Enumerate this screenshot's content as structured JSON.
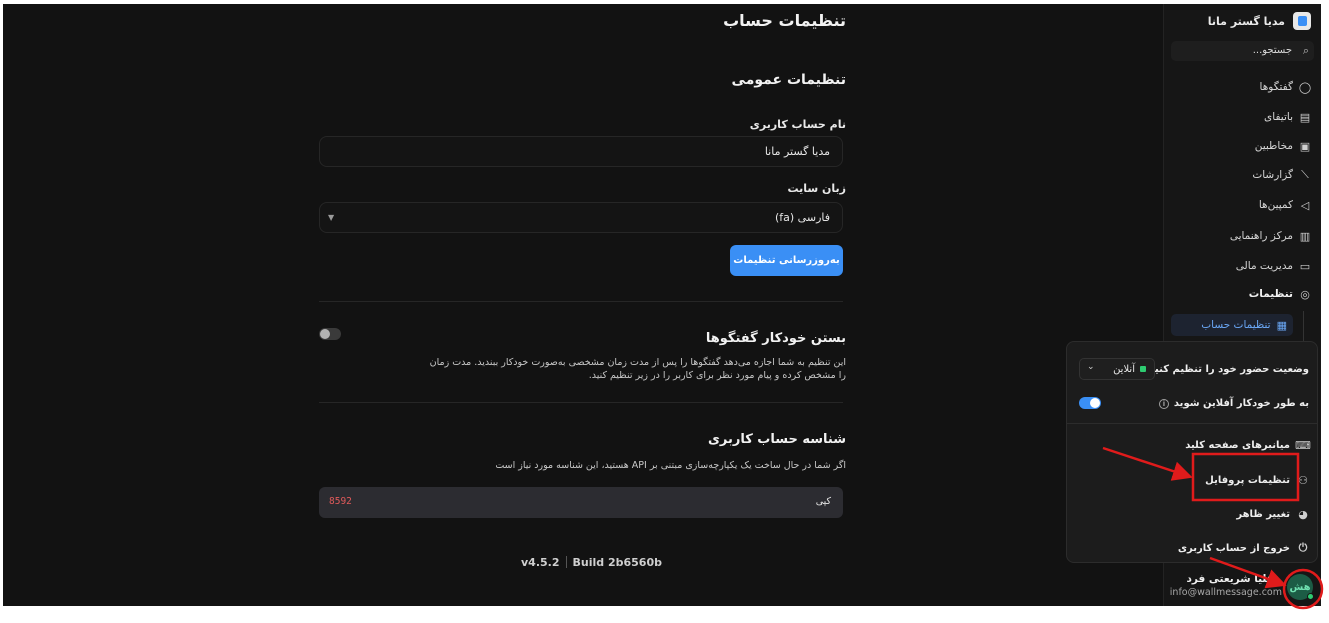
{
  "content": {
    "page_title": "تنظیمات حساب",
    "general_title": "تنظیمات عمومی",
    "username_label": "نام حساب کاربری",
    "username_value": "مدیا گستر مانا",
    "language_label": "زبان سایت",
    "language_value": "فارسی (fa)",
    "update_button": "به‌روزرسانی تنظیمات",
    "autoclose_title": "بستن خودکار گفتگوها",
    "autoclose_desc": "این تنظیم به شما اجازه می‌دهد گفتگوها را پس از مدت زمان مشخصی به‌صورت خودکار ببندید. مدت زمان را مشخص کرده و پیام مورد نظر برای کاربر را در زیر تنظیم کنید.",
    "api_title": "شناسه حساب کاربری",
    "api_desc": "اگر شما در حال ساخت یک یکپارچه‌سازی مبتنی بر API هستید، این شناسه مورد نیاز است",
    "api_label": "کپی",
    "api_value": "8592",
    "version": "v4.5.2",
    "build": "Build 2b6560b"
  },
  "sidebar": {
    "brand": "مدیا گستر مانا",
    "search_placeholder": "جستجو...",
    "items": [
      {
        "label": "گفتگوها",
        "icon": "chat-icon"
      },
      {
        "label": "باتیفای",
        "icon": "bot-icon"
      },
      {
        "label": "مخاطبین",
        "icon": "contacts-icon"
      },
      {
        "label": "گزارشات",
        "icon": "reports-icon"
      },
      {
        "label": "کمپین‌ها",
        "icon": "campaign-icon"
      },
      {
        "label": "مرکز راهنمایی",
        "icon": "help-center-icon"
      },
      {
        "label": "مدیریت مالی",
        "icon": "wallet-icon"
      },
      {
        "label": "تنظیمات",
        "icon": "settings-icon"
      }
    ],
    "active_sub": "تنظیمات حساب",
    "user": {
      "name": "هلیا شریعتی فرد",
      "email": "info@wallmessage.com",
      "initials": "هش"
    }
  },
  "popup": {
    "presence_label": "وضعیت حضور خود را تنظیم کنید",
    "status": "آنلاین",
    "auto_offline": "به طور خودکار آفلاین شوید",
    "items": [
      {
        "label": "میانبرهای صفحه کلید",
        "icon": "keyboard-icon"
      },
      {
        "label": "تنظیمات پروفایل",
        "icon": "user-icon"
      },
      {
        "label": "تغییر ظاهر",
        "icon": "palette-icon"
      },
      {
        "label": "خروج از حساب کاربری",
        "icon": "power-icon"
      }
    ]
  },
  "colors": {
    "accent": "#3a8ff5",
    "background": "#121212",
    "annotation": "#e01b1b",
    "online": "#2ecc71"
  }
}
